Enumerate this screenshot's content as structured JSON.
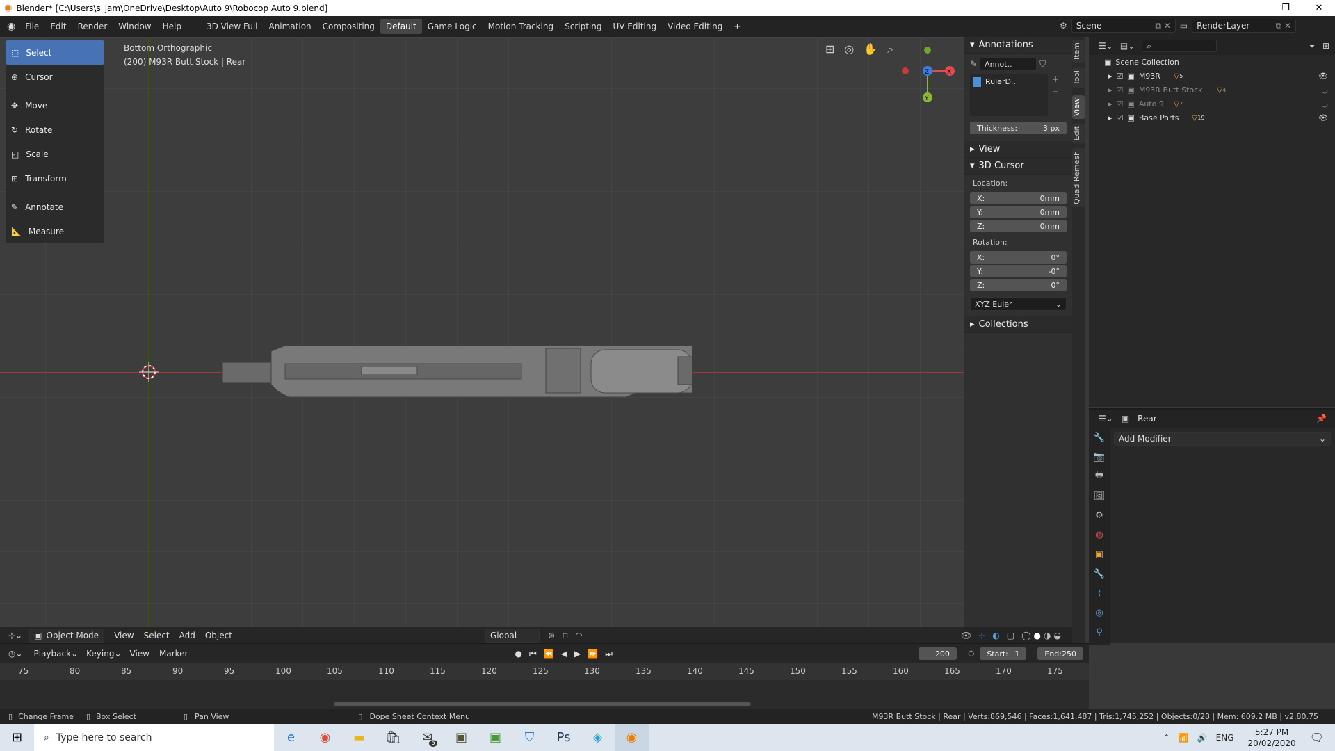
{
  "window": {
    "title": "Blender* [C:\\Users\\s_jam\\OneDrive\\Desktop\\Auto 9\\Robocop Auto 9.blend]"
  },
  "menu": [
    "File",
    "Edit",
    "Render",
    "Window",
    "Help"
  ],
  "workspaces": [
    "3D View Full",
    "Animation",
    "Compositing",
    "Default",
    "Game Logic",
    "Motion Tracking",
    "Scripting",
    "UV Editing",
    "Video Editing"
  ],
  "active_workspace": "Default",
  "scene": {
    "name": "Scene",
    "render_layer": "RenderLayer"
  },
  "tools": {
    "select": "Select",
    "cursor": "Cursor",
    "move": "Move",
    "rotate": "Rotate",
    "scale": "Scale",
    "transform": "Transform",
    "annotate": "Annotate",
    "measure": "Measure"
  },
  "viewport": {
    "view_name": "Bottom Orthographic",
    "object_info": "(200) M93R Butt Stock | Rear",
    "gizmo": {
      "x": "X",
      "y": "Y",
      "z": "Z"
    }
  },
  "npanel": {
    "annotations": {
      "title": "Annotations",
      "layer_name": "Annot..",
      "ruler": "RulerD..",
      "thickness_label": "Thickness:",
      "thickness_value": "3 px"
    },
    "view": "View",
    "cursor": {
      "title": "3D Cursor",
      "location_label": "Location:",
      "loc": {
        "x": "0mm",
        "y": "0mm",
        "z": "0mm"
      },
      "rotation_label": "Rotation:",
      "rot": {
        "x": "0°",
        "y": "-0°",
        "z": "0°"
      },
      "mode": "XYZ Euler",
      "axis_x": "X:",
      "axis_y": "Y:",
      "axis_z": "Z:"
    },
    "collections": "Collections",
    "tabs": [
      "Item",
      "Tool",
      "View",
      "Edit",
      "Quad Remesh"
    ]
  },
  "outliner": {
    "root": "Scene Collection",
    "items": [
      {
        "name": "M93R",
        "count": "5"
      },
      {
        "name": "M93R Butt Stock",
        "count": "4"
      },
      {
        "name": "Auto 9",
        "count": "7"
      },
      {
        "name": "Base Parts",
        "count": "19"
      }
    ]
  },
  "properties": {
    "object": "Rear",
    "add_modifier": "Add Modifier"
  },
  "vpheader": {
    "mode": "Object Mode",
    "view": "View",
    "select": "Select",
    "add": "Add",
    "object": "Object",
    "orientation": "Global"
  },
  "timeline": {
    "playback": "Playback",
    "keying": "Keying",
    "view": "View",
    "marker": "Marker",
    "frame": "200",
    "start_label": "Start:",
    "start": "1",
    "end_label": "End:",
    "end": "250",
    "ticks": [
      "75",
      "80",
      "85",
      "90",
      "95",
      "100",
      "105",
      "110",
      "115",
      "120",
      "125",
      "130",
      "135",
      "140",
      "145",
      "150",
      "155",
      "160",
      "165",
      "170",
      "175"
    ]
  },
  "statusbar": {
    "change_frame": "Change Frame",
    "box_select": "Box Select",
    "pan_view": "Pan View",
    "context_menu": "Dope Sheet Context Menu",
    "stats": "M93R Butt Stock | Rear | Verts:869,546 | Faces:1,641,487 | Tris:1,745,252 | Objects:0/28 | Mem: 609.2 MB | v2.80.75"
  },
  "taskbar": {
    "search_placeholder": "Type here to search",
    "lang": "ENG",
    "time": "5:27 PM",
    "date": "20/02/2020",
    "mail_badge": "5"
  }
}
